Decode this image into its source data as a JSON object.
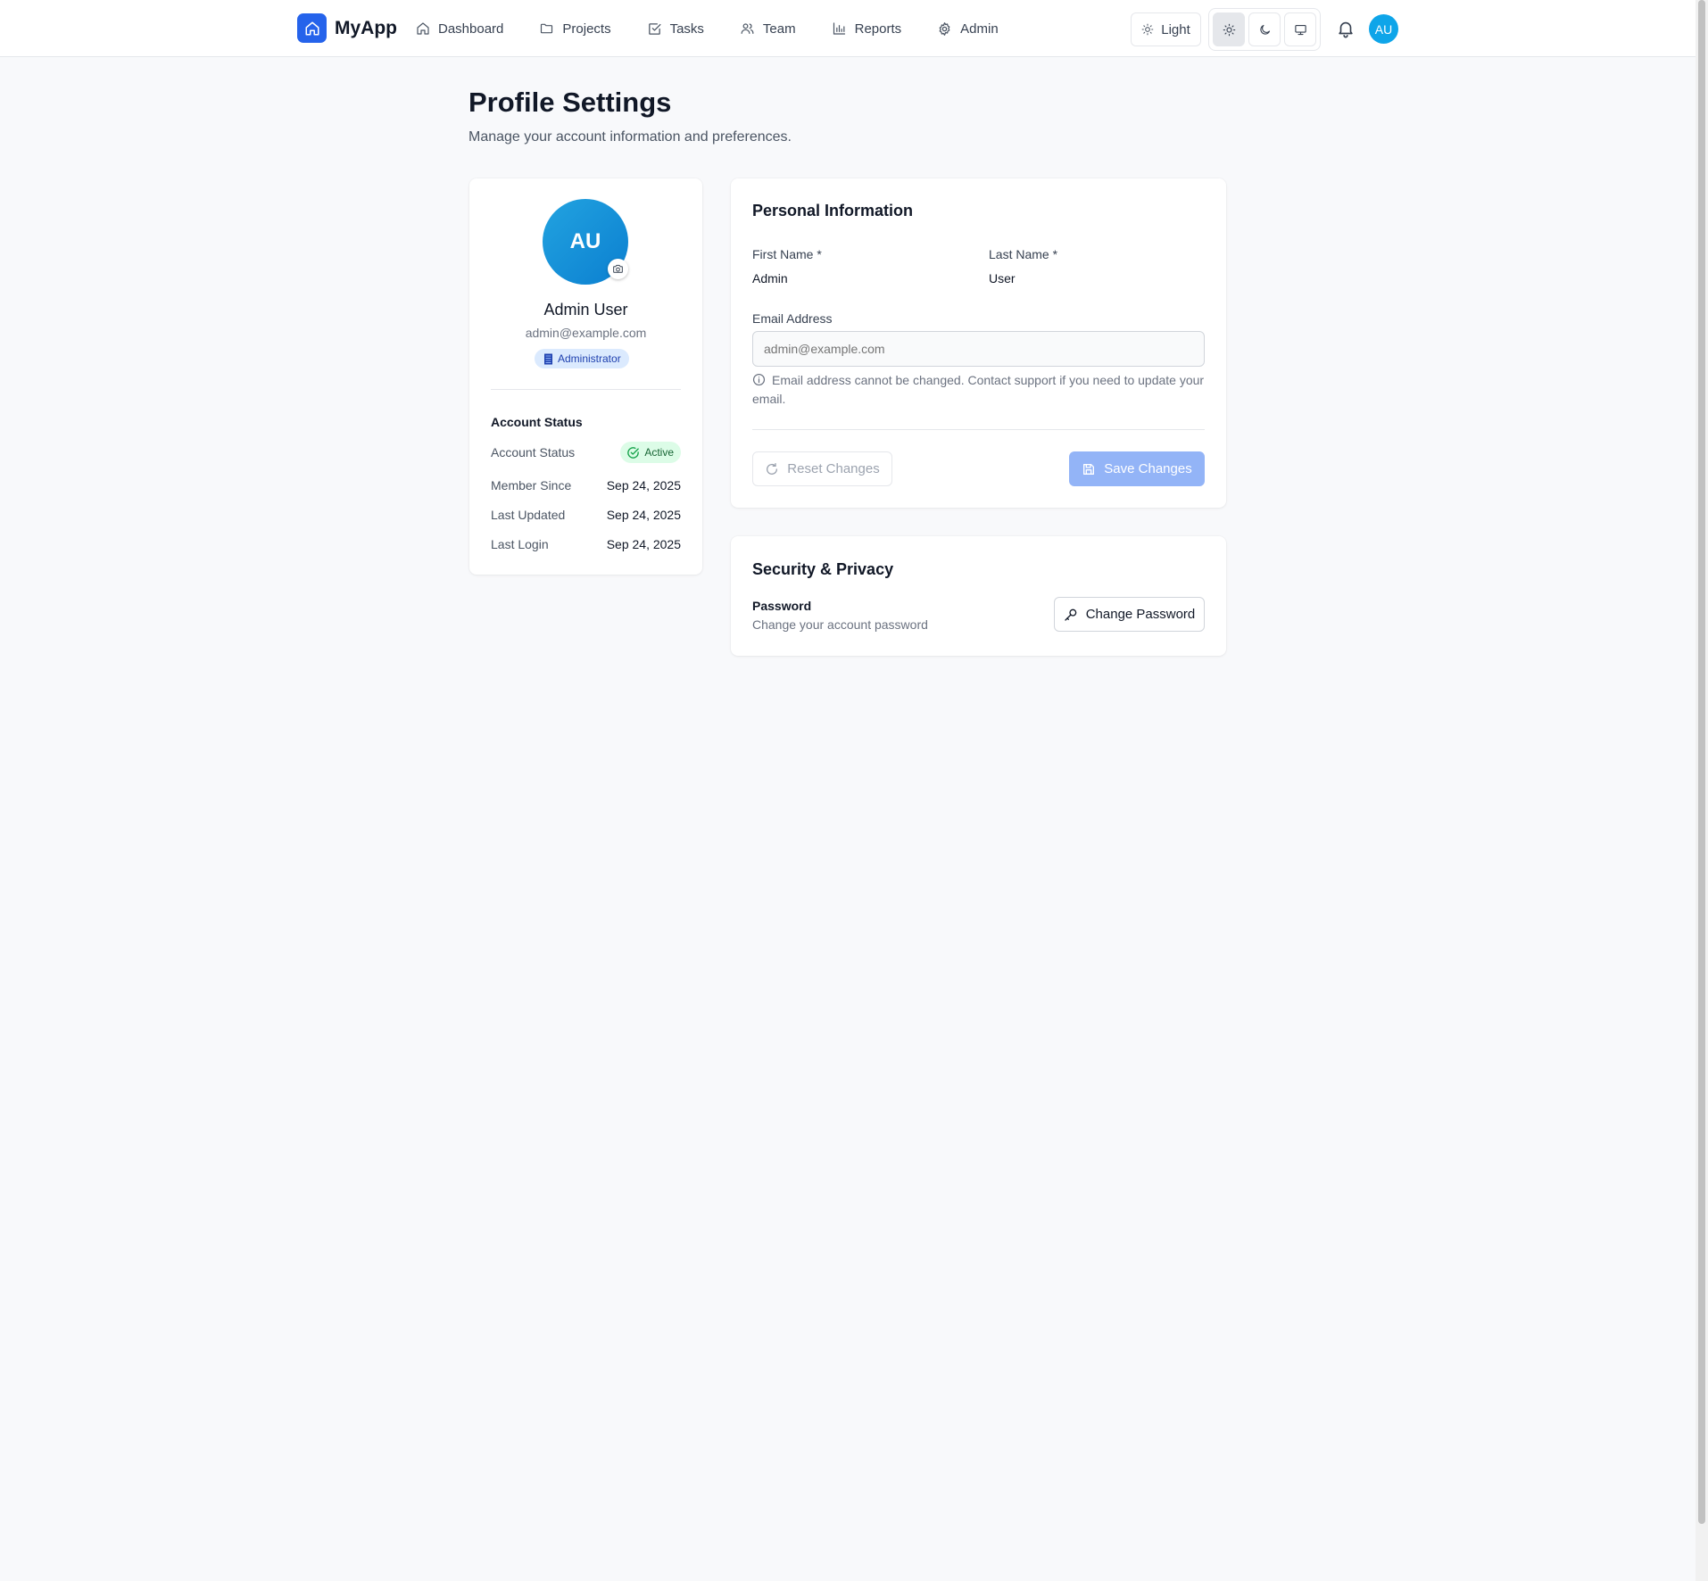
{
  "app": {
    "name": "MyApp"
  },
  "nav": {
    "items": [
      {
        "label": "Dashboard",
        "icon": "home-icon"
      },
      {
        "label": "Projects",
        "icon": "folder-icon"
      },
      {
        "label": "Tasks",
        "icon": "check-square-icon"
      },
      {
        "label": "Team",
        "icon": "users-icon"
      },
      {
        "label": "Reports",
        "icon": "bar-chart-icon"
      },
      {
        "label": "Admin",
        "icon": "gear-icon"
      }
    ],
    "theme_label": "Light",
    "theme_options": [
      "sun-icon",
      "moon-icon",
      "monitor-icon"
    ],
    "theme_selected": "light",
    "avatar_initials": "AU"
  },
  "page": {
    "title": "Profile Settings",
    "subtitle": "Manage your account information and preferences."
  },
  "profile": {
    "initials": "AU",
    "name": "Admin User",
    "email": "admin@example.com",
    "role": "Administrator",
    "account_status_heading": "Account Status",
    "rows": [
      {
        "label": "Account Status",
        "value": "Active"
      },
      {
        "label": "Member Since",
        "value": "Sep 24, 2025"
      },
      {
        "label": "Last Updated",
        "value": "Sep 24, 2025"
      },
      {
        "label": "Last Login",
        "value": "Sep 24, 2025"
      }
    ]
  },
  "personal": {
    "title": "Personal Information",
    "first_name_label": "First Name *",
    "first_name_value": "Admin",
    "last_name_label": "Last Name *",
    "last_name_value": "User",
    "email_label": "Email Address",
    "email_placeholder": "admin@example.com",
    "email_help": "Email address cannot be changed. Contact support if you need to update your email.",
    "reset_label": "Reset Changes",
    "save_label": "Save Changes"
  },
  "security": {
    "title": "Security & Privacy",
    "password_label": "Password",
    "password_desc": "Change your account password",
    "change_label": "Change Password"
  },
  "colors": {
    "primary": "#2563eb",
    "save_disabled": "#93b4f7",
    "avatar": "#0ea5e9",
    "success_bg": "#dcfce7",
    "success_fg": "#166534",
    "role_bg": "#dbeafe",
    "role_fg": "#1e40af"
  }
}
